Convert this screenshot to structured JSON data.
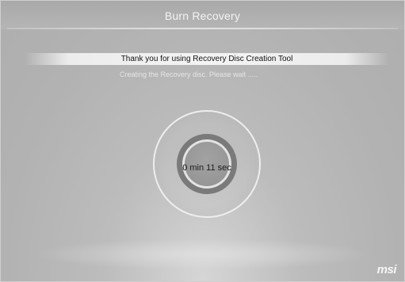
{
  "window": {
    "title": "Burn Recovery"
  },
  "info": {
    "banner": "Thank you for using Recovery Disc Creation Tool"
  },
  "status": {
    "message": "Creating the Recovery disc. Please wait ....."
  },
  "timer": {
    "elapsed": "0 min 11 sec"
  },
  "brand": {
    "logo": "msi"
  }
}
